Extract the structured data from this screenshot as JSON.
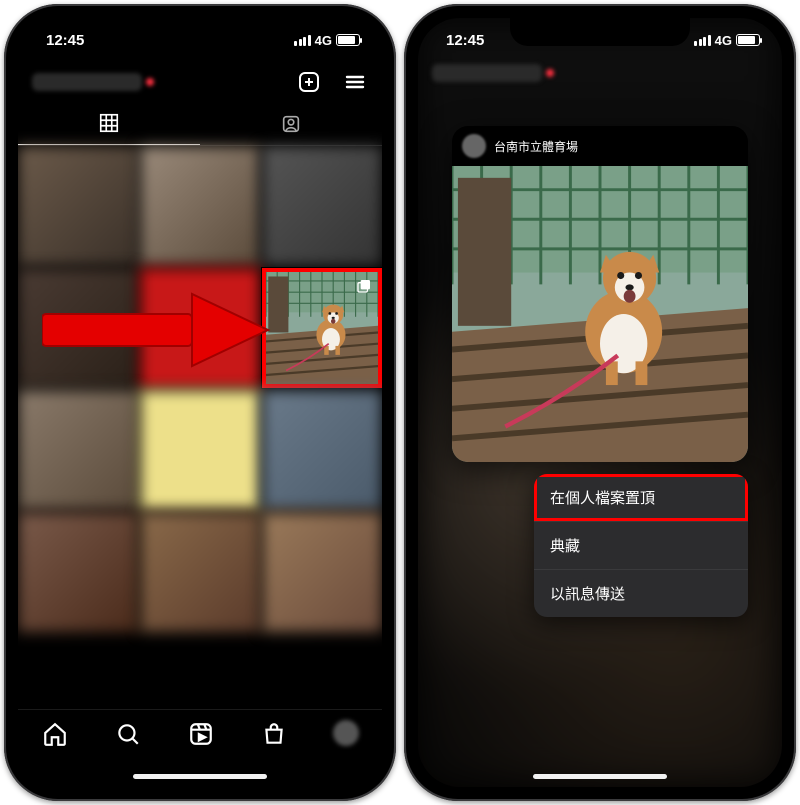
{
  "status": {
    "time": "12:45",
    "network": "4G"
  },
  "left": {
    "tabs": {
      "grid": "grid-icon",
      "tagged": "tagged-icon"
    },
    "highlight_cell_index": 5,
    "bottom_tabs": [
      "home",
      "search",
      "reels",
      "shop",
      "profile"
    ]
  },
  "right": {
    "preview": {
      "location": "台南市立體育場"
    },
    "menu": {
      "items": [
        {
          "label": "在個人檔案置頂",
          "highlighted": true
        },
        {
          "label": "典藏",
          "highlighted": false
        },
        {
          "label": "以訊息傳送",
          "highlighted": false
        }
      ]
    }
  },
  "icons": {
    "new_post": "new-post-icon",
    "hamburger": "hamburger-icon",
    "grid": "grid-icon",
    "tagged": "tagged-icon",
    "home": "home-icon",
    "search": "search-icon",
    "reels": "reels-icon",
    "shop": "shop-icon"
  }
}
